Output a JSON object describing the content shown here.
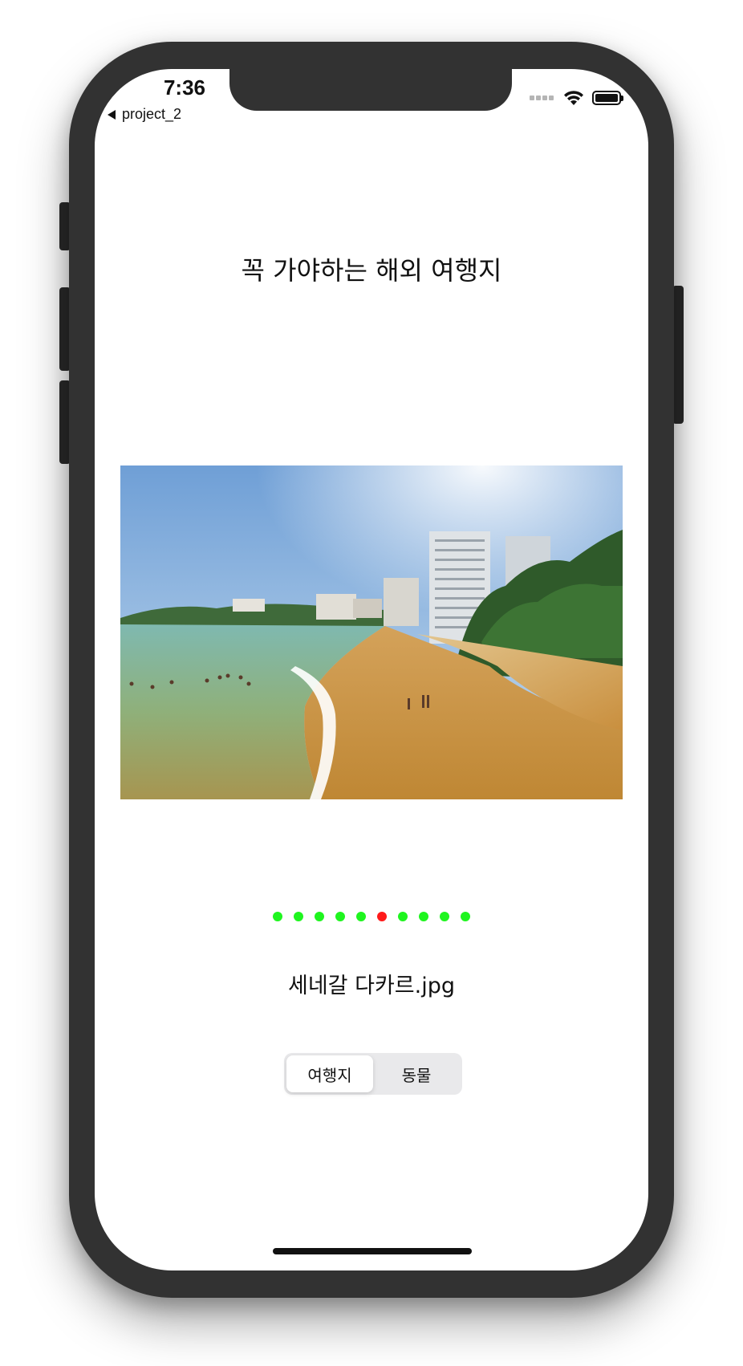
{
  "status_bar": {
    "time": "7:36",
    "back_label": "project_2"
  },
  "main": {
    "title": "꼭 가야하는 해외 여행지",
    "image_caption": "세네갈 다카르.jpg",
    "page_control": {
      "count": 10,
      "current_index": 5
    },
    "segmented_control": {
      "options": [
        "여행지",
        "동물"
      ],
      "selected_index": 0
    }
  },
  "colors": {
    "phone_frame": "#323232",
    "dot_inactive": "#1ff51f",
    "dot_active": "#ff1a1a"
  },
  "icons": [
    "back-arrow-icon",
    "wifi-icon",
    "battery-icon",
    "cellular-signal-icon"
  ]
}
